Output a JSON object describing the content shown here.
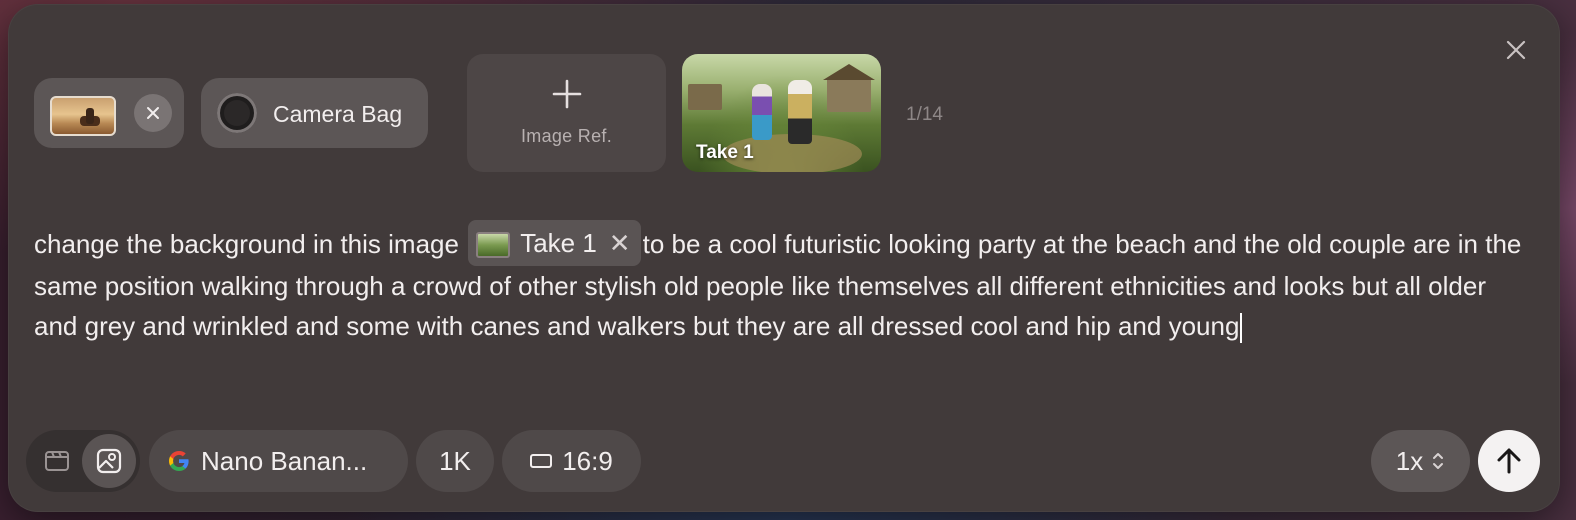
{
  "header": {
    "camera_chip_label": "Camera Bag",
    "image_ref_label": "Image Ref.",
    "take_label": "Take 1",
    "counter": "1/14"
  },
  "prompt": {
    "text_before": "change the background in this image",
    "chip_label": "Take 1",
    "text_after": "to be a cool futuristic looking party at the beach and the old couple are in the same position walking through a crowd of other stylish old people like themselves all different ethnicities and looks but all older and grey and wrinkled and some with canes and walkers but they are all dressed cool and hip and young"
  },
  "toolbar": {
    "model": "Nano Banan...",
    "resolution": "1K",
    "aspect_ratio": "16:9",
    "count": "1x"
  },
  "icons": {
    "close": "close-icon",
    "remove": "x-icon",
    "add": "plus-icon",
    "video_mode": "video-mode-icon",
    "image_mode": "image-mode-icon",
    "google": "google-icon",
    "aspect": "aspect-ratio-icon",
    "stepper": "chevron-updown-icon",
    "send": "arrow-up-icon"
  },
  "colors": {
    "panel": "#413a3a",
    "chip": "#5c5656",
    "text": "#f2eeee",
    "send_button": "#f4f2f2"
  }
}
